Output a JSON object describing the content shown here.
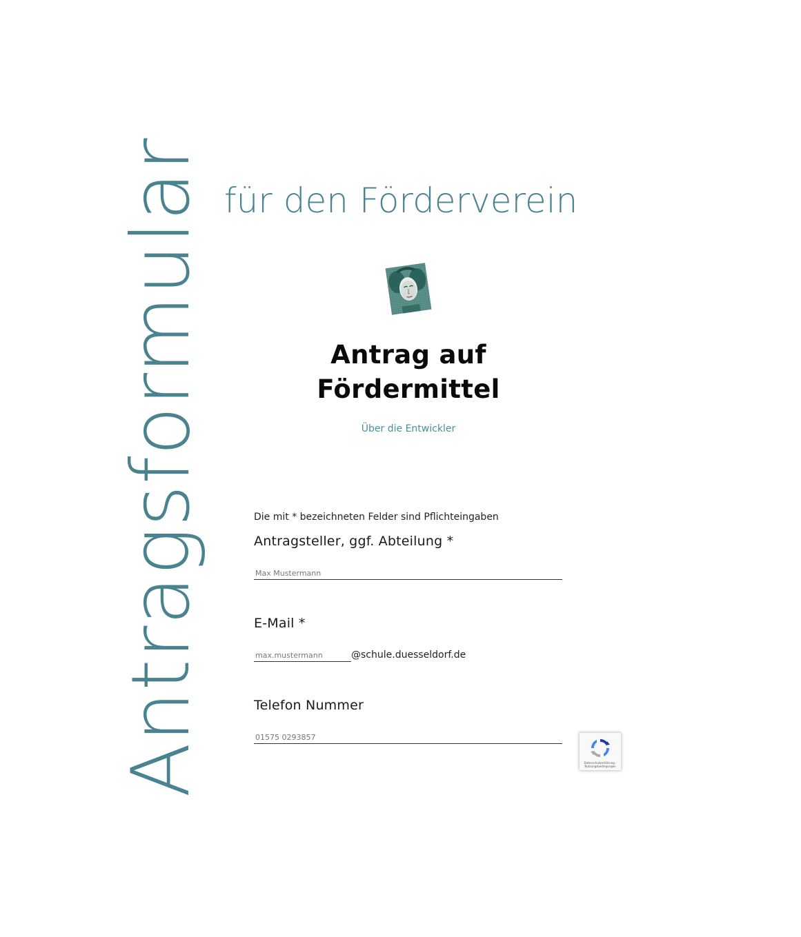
{
  "side_title": "Antragsformular",
  "subtitle": "für den Förderverein",
  "heading": {
    "line1": "Antrag auf",
    "line2": "Fördermittel"
  },
  "about_link": "Über die Entwickler",
  "required_note": "Die mit * bezeichneten Felder sind Pflichteingaben",
  "fields": {
    "applicant": {
      "label": "Antragsteller, ggf. Abteilung *",
      "placeholder": "Max Mustermann"
    },
    "email": {
      "label": "E-Mail *",
      "placeholder": "max.mustermann",
      "suffix": "@schule.duesseldorf.de"
    },
    "phone": {
      "label": "Telefon Nummer",
      "placeholder": "01575 0293857"
    }
  },
  "recaptcha": {
    "footer": "Datenschutzerklärung - Nutzungsbedingungen"
  },
  "colors": {
    "accent": "#4a8390",
    "link": "#4a8f96",
    "heading": "#0a0a0a"
  },
  "icons": {
    "portrait": "portrait-image",
    "recaptcha": "recaptcha-icon"
  }
}
